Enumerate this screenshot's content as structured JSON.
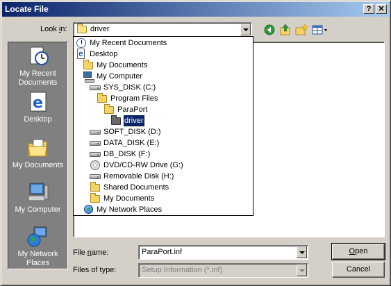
{
  "window": {
    "title": "Locate File",
    "help_btn": "?",
    "close_btn": "✕"
  },
  "lookin": {
    "label_pre": "Look ",
    "label_acc": "i",
    "label_post": "n:",
    "value": "driver"
  },
  "places": [
    {
      "label": "My Recent\nDocuments",
      "icon": "recent-documents-icon"
    },
    {
      "label": "Desktop",
      "icon": "desktop-icon"
    },
    {
      "label": "My Documents",
      "icon": "my-documents-icon"
    },
    {
      "label": "My Computer",
      "icon": "my-computer-icon"
    },
    {
      "label": "My Network\nPlaces",
      "icon": "network-places-icon"
    }
  ],
  "dropdown": {
    "items": [
      {
        "label": "My Recent Documents",
        "icon": "recent-icon"
      },
      {
        "label": "Desktop",
        "icon": "desktop-icon"
      },
      {
        "label": "My Documents",
        "icon": "folder-icon"
      },
      {
        "label": "My Computer",
        "icon": "computer-icon"
      },
      {
        "label": "SYS_DISK (C:)",
        "icon": "drive-icon"
      },
      {
        "label": "Program Files",
        "icon": "folder-icon"
      },
      {
        "label": "ParaPort",
        "icon": "folder-icon"
      },
      {
        "label": "driver",
        "icon": "folder-icon",
        "selected": true
      },
      {
        "label": "SOFT_DISK (D:)",
        "icon": "drive-icon"
      },
      {
        "label": "DATA_DISK (E:)",
        "icon": "drive-icon"
      },
      {
        "label": "DB_DISK (F:)",
        "icon": "drive-icon"
      },
      {
        "label": "DVD/CD-RW Drive (G:)",
        "icon": "cd-drive-icon"
      },
      {
        "label": "Removable Disk (H:)",
        "icon": "drive-icon"
      },
      {
        "label": "Shared Documents",
        "icon": "folder-icon"
      },
      {
        "label": "My Documents",
        "icon": "folder-icon"
      },
      {
        "label": "My Network Places",
        "icon": "network-icon"
      }
    ]
  },
  "filename": {
    "label_pre": "File ",
    "label_acc": "n",
    "label_post": "ame:",
    "value": "ParaPort.inf"
  },
  "filetype": {
    "label": "Files of type:",
    "value": "Setup Information (*.inf)"
  },
  "buttons": {
    "open_acc": "O",
    "open_rest": "pen",
    "cancel": "Cancel"
  },
  "colors": {
    "title_bar": "#0a246a",
    "selection": "#0a246a",
    "face": "#d4d0c8",
    "places_bar": "#808080"
  }
}
